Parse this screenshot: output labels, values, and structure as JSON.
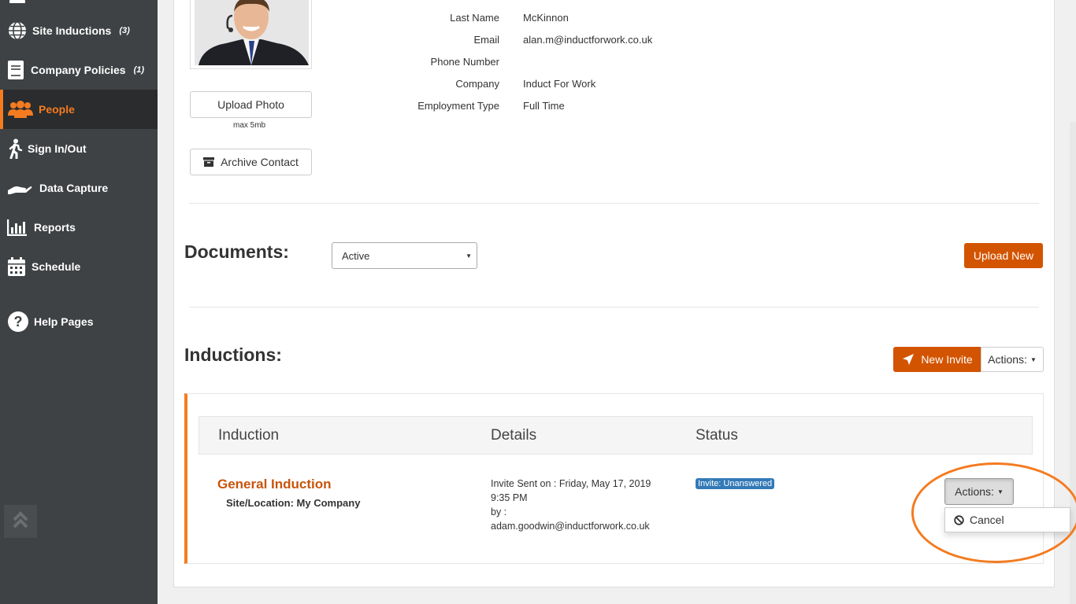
{
  "sidebar": {
    "items": [
      {
        "label": "Site Inductions",
        "count": "(3)",
        "icon": "globe-icon"
      },
      {
        "label": "Company Policies",
        "count": "(1)",
        "icon": "book-icon"
      },
      {
        "label": "People",
        "count": "",
        "icon": "users-icon",
        "active": true
      },
      {
        "label": "Sign In/Out",
        "count": "",
        "icon": "walking-icon"
      },
      {
        "label": "Data Capture",
        "count": "",
        "icon": "hand-icon"
      },
      {
        "label": "Reports",
        "count": "",
        "icon": "bar-chart-icon"
      },
      {
        "label": "Schedule",
        "count": "",
        "icon": "calendar-icon"
      },
      {
        "label": "Help Pages",
        "count": "",
        "icon": "question-icon"
      }
    ]
  },
  "profile": {
    "upload_photo_label": "Upload Photo",
    "upload_hint": "max 5mb",
    "archive_label": "Archive Contact",
    "fields": [
      {
        "label": "Last Name",
        "value": "McKinnon"
      },
      {
        "label": "Email",
        "value": "alan.m@inductforwork.co.uk"
      },
      {
        "label": "Phone Number",
        "value": ""
      },
      {
        "label": "Company",
        "value": "Induct For Work"
      },
      {
        "label": "Employment Type",
        "value": "Full Time"
      }
    ]
  },
  "documents": {
    "title": "Documents:",
    "filter_value": "Active",
    "upload_label": "Upload New"
  },
  "inductions": {
    "title": "Inductions:",
    "new_invite_label": "New Invite",
    "actions_label": "Actions:",
    "columns": [
      "Induction",
      "Details",
      "Status"
    ],
    "rows": [
      {
        "name": "General Induction",
        "site": "Site/Location: My Company",
        "details": [
          "Invite Sent on : Friday, May 17, 2019",
          "9:35 PM",
          "by :",
          "adam.goodwin@inductforwork.co.uk"
        ],
        "status": "Invite: Unanswered",
        "actions_label": "Actions:",
        "menu": [
          "Cancel"
        ]
      }
    ]
  },
  "colors": {
    "sidebar_bg": "#3f4244",
    "accent": "#f47b20",
    "button_orange": "#d35400",
    "badge_blue": "#337ab7"
  }
}
